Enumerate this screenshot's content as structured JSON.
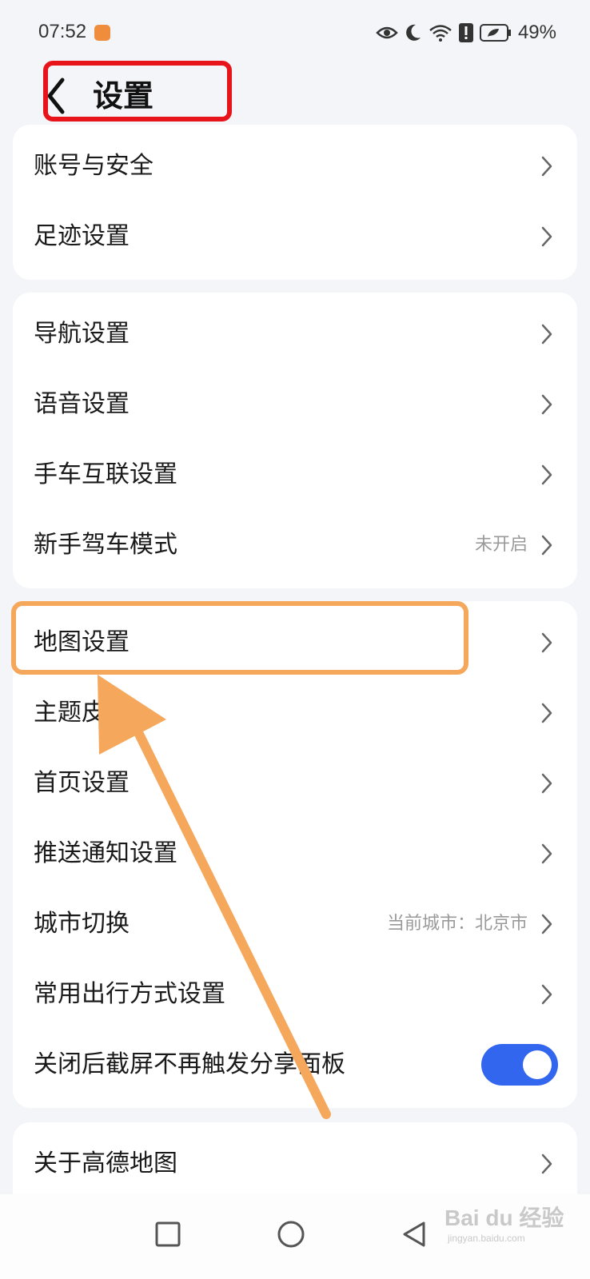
{
  "status_bar": {
    "time": "07:52",
    "battery": "49%",
    "icons": [
      "app-badge-icon",
      "eye-icon",
      "moon-icon",
      "wifi-icon",
      "alert-icon",
      "battery-icon"
    ]
  },
  "header": {
    "title": "设置",
    "back_icon": "chevron-left-icon"
  },
  "cards": [
    {
      "rows": [
        {
          "label": "账号与安全"
        },
        {
          "label": "足迹设置"
        }
      ]
    },
    {
      "rows": [
        {
          "label": "导航设置"
        },
        {
          "label": "语音设置"
        },
        {
          "label": "手车互联设置"
        },
        {
          "label": "新手驾车模式",
          "value": "未开启"
        }
      ]
    },
    {
      "rows": [
        {
          "label": "地图设置"
        },
        {
          "label": "主题皮肤"
        },
        {
          "label": "首页设置"
        },
        {
          "label": "推送通知设置"
        },
        {
          "label": "城市切换",
          "value": "当前城市：北京市"
        },
        {
          "label": "常用出行方式设置"
        },
        {
          "label": "关闭后截屏不再触发分享面板",
          "toggle": true
        }
      ]
    },
    {
      "rows": [
        {
          "label": "关于高德地图"
        }
      ]
    }
  ],
  "colors": {
    "background": "#f4f5f8",
    "card": "#ffffff",
    "toggle_on": "#3366ee",
    "title_highlight": "#e8141c",
    "annotation_orange": "#f5a85c"
  },
  "nav_bar": {
    "icons": [
      "square-icon",
      "circle-icon",
      "triangle-back-icon"
    ]
  },
  "watermark": {
    "text": "Bai du 经验",
    "sub": "jingyan.baidu.com"
  }
}
